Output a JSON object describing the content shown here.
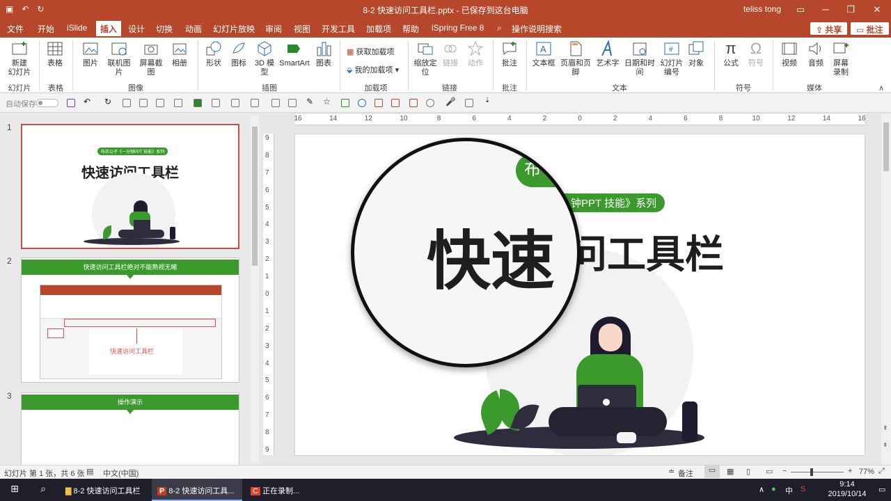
{
  "titlebar": {
    "doc_title": "8-2 快速访问工具栏.pptx - 已保存到这台电脑",
    "user": "teliss tong",
    "minimize": "─",
    "restore": "❐",
    "close": "✕"
  },
  "menu": {
    "tabs": [
      "文件",
      "开始",
      "iSlide",
      "插入",
      "设计",
      "切换",
      "动画",
      "幻灯片放映",
      "审阅",
      "视图",
      "开发工具",
      "加载项",
      "帮助",
      "iSpring Free 8"
    ],
    "active_tab": "插入",
    "search": "操作说明搜索",
    "share": "共享",
    "comment": "批注"
  },
  "ribbon": {
    "buttons": {
      "new_slide": "新建\n幻灯片",
      "table": "表格",
      "picture": "图片",
      "online_picture": "联机图片",
      "screenshot": "屏幕截图",
      "album": "相册",
      "shapes": "形状",
      "icons": "图标",
      "model3d": "3D 模\n型",
      "smartart": "SmartArt",
      "chart": "图表",
      "get_addins": "获取加载项",
      "my_addins": "我的加载项",
      "zoom": "缩放定\n位",
      "link": "链接",
      "action": "动作",
      "comment": "批注",
      "textbox": "文本框",
      "header_footer": "页眉和页脚",
      "wordart": "艺术字",
      "datetime": "日期和时间",
      "slide_number": "幻灯片\n编号",
      "object": "对象",
      "equation": "公式",
      "symbol": "符号",
      "video": "视频",
      "audio": "音频",
      "screen_record": "屏幕\n录制"
    },
    "groups": {
      "slides": "幻灯片",
      "tables": "表格",
      "images": "图像",
      "illustrations": "插图",
      "addins": "加载项",
      "links": "链接",
      "comments": "批注",
      "text": "文本",
      "symbols": "符号",
      "media": "媒体"
    }
  },
  "qat": {
    "autosave": "自动保存"
  },
  "thumbnails": {
    "numbers": [
      "1",
      "2",
      "3"
    ],
    "slide1_pill": "布衣公子《一分钟PPT 技能》系列",
    "slide1_title": "快速访问工具栏",
    "slide2_banner": "快速访问工具栏绝对不能熟视无睹",
    "slide2_caption": "快速访问工具栏",
    "slide3_banner": "操作演示"
  },
  "ruler": {
    "h_ticks": [
      "16",
      "14",
      "12",
      "10",
      "8",
      "6",
      "4",
      "2",
      "0",
      "2",
      "4",
      "6",
      "8",
      "10",
      "12",
      "14",
      "16"
    ],
    "v_ticks": [
      "9",
      "8",
      "7",
      "6",
      "5",
      "4",
      "3",
      "2",
      "1",
      "0",
      "1",
      "2",
      "3",
      "4",
      "5",
      "6",
      "7",
      "8",
      "9"
    ]
  },
  "slide": {
    "pill_partial": "布",
    "pill_text": "钟PPT 技能》系列",
    "title_magnified": "快速",
    "title_rest": "问工具栏"
  },
  "status": {
    "slide_info": "幻灯片 第 1 张，共 6 张",
    "language": "中文(中国)",
    "notes": "备注",
    "zoom": "77%"
  },
  "taskbar": {
    "item1": "8-2 快速访问工具栏",
    "item2": "8-2 快速访问工具...",
    "item3": "正在录制...",
    "time": "9:14",
    "date": "2019/10/14",
    "ime": "中"
  },
  "colors": {
    "accent": "#b7472a",
    "green": "#3a9a2c",
    "dark": "#1e1e1e"
  }
}
